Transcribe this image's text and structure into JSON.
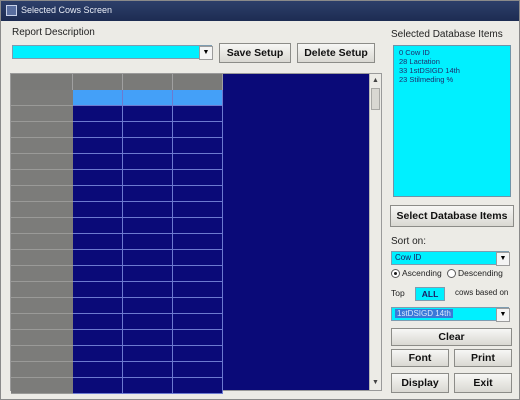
{
  "window": {
    "title": "Selected Cows Screen"
  },
  "report": {
    "label": "Report Description",
    "value": ""
  },
  "buttons": {
    "save_setup": "Save Setup",
    "delete_setup": "Delete Setup",
    "select_db_items": "Select Database Items",
    "clear": "Clear",
    "font": "Font",
    "print": "Print",
    "display": "Display",
    "exit": "Exit"
  },
  "selected_items": {
    "label": "Selected Database Items",
    "items": [
      "0 Cow ID",
      "28 Lactation",
      "33 1stDSIGD 14th",
      "23 Stilmeding %"
    ]
  },
  "sort": {
    "label": "Sort on:",
    "value": "Cow ID",
    "ascending_label": "Ascending",
    "descending_label": "Descending",
    "selected": "ascending"
  },
  "top": {
    "label": "Top",
    "value": "ALL",
    "based_on_label": "cows based on",
    "based_on_value": "1stDSIGD 14th"
  },
  "grid": {
    "header_columns": 3,
    "data_rows": 19,
    "selected_row": 0
  },
  "colors": {
    "grid_cell": "#0a0a78",
    "grid_selected": "#44a0f8",
    "field_fill": "#00f0ff",
    "title_bar": "#1d2c52"
  }
}
